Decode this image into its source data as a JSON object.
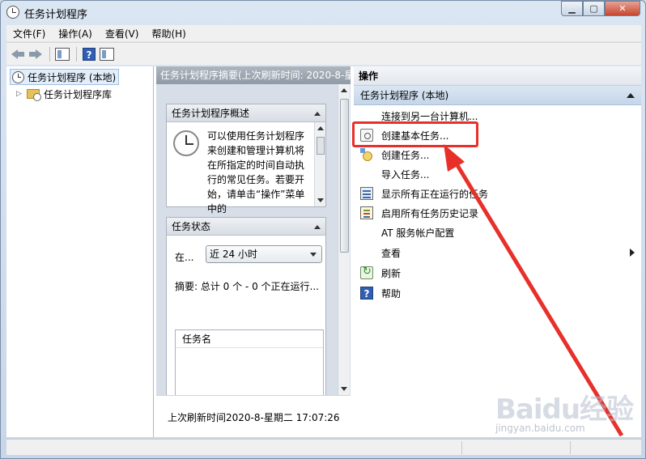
{
  "window": {
    "title": "任务计划程序"
  },
  "menu": {
    "items": [
      "文件(F)",
      "操作(A)",
      "查看(V)",
      "帮助(H)"
    ]
  },
  "tree": {
    "root": "任务计划程序 (本地)",
    "child": "任务计划程序库"
  },
  "middle": {
    "header": "任务计划程序摘要(上次刷新时间: 2020-8-星",
    "overview": {
      "title": "任务计划程序概述",
      "text": "可以使用任务计划程序来创建和管理计算机将在所指定的时间自动执行的常见任务。若要开始，请单击“操作”菜单中的"
    },
    "status": {
      "title": "任务状态",
      "in_label": "在...",
      "range": "近 24 小时",
      "summary": "摘要: 总计 0 个 - 0 个正在运行...",
      "list_header": "任务名"
    },
    "last_refresh": "上次刷新时间2020-8-星期二 17:07:26"
  },
  "actions": {
    "title": "操作",
    "group": "任务计划程序 (本地)",
    "items": [
      {
        "label": "连接到另一台计算机...",
        "icon": "none"
      },
      {
        "label": "创建基本任务...",
        "icon": "wizard-icon"
      },
      {
        "label": "创建任务...",
        "icon": "create-task-icon"
      },
      {
        "label": "导入任务...",
        "icon": "none"
      },
      {
        "label": "显示所有正在运行的任务",
        "icon": "running-tasks-icon"
      },
      {
        "label": "启用所有任务历史记录",
        "icon": "history-icon"
      },
      {
        "label": "AT 服务帐户配置",
        "icon": "none"
      },
      {
        "label": "查看",
        "icon": "none"
      },
      {
        "label": "刷新",
        "icon": "refresh-icon"
      },
      {
        "label": "帮助",
        "icon": "help-icon"
      }
    ]
  },
  "watermark": {
    "brand": "Baidu经验",
    "url": "jingyan.baidu.com"
  },
  "colors": {
    "annotation": "#e8302a",
    "accent": "#c5d6ea"
  }
}
